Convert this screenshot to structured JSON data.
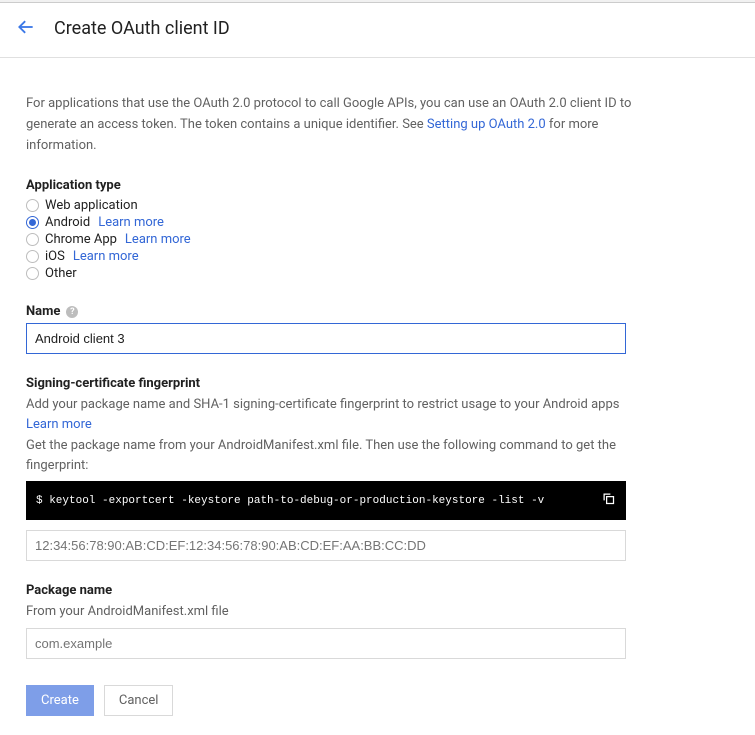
{
  "header": {
    "title": "Create OAuth client ID"
  },
  "intro": {
    "text_before": "For applications that use the OAuth 2.0 protocol to call Google APIs, you can use an OAuth 2.0 client ID to generate an access token. The token contains a unique identifier. See ",
    "link": "Setting up OAuth 2.0",
    "text_after": " for more information."
  },
  "app_type": {
    "label": "Application type",
    "options": [
      {
        "label": "Web application",
        "learn_more": null,
        "checked": false
      },
      {
        "label": "Android",
        "learn_more": "Learn more",
        "checked": true
      },
      {
        "label": "Chrome App",
        "learn_more": "Learn more",
        "checked": false
      },
      {
        "label": "iOS",
        "learn_more": "Learn more",
        "checked": false
      },
      {
        "label": "Other",
        "learn_more": null,
        "checked": false
      }
    ]
  },
  "name": {
    "label": "Name",
    "value": "Android client 3"
  },
  "fingerprint": {
    "label": "Signing-certificate fingerprint",
    "helper_before": "Add your package name and SHA-1 signing-certificate fingerprint to restrict usage to your Android apps ",
    "helper_link": "Learn more",
    "helper2": "Get the package name from your AndroidManifest.xml file. Then use the following command to get the fingerprint:",
    "command_prefix": "$ ",
    "command": "keytool -exportcert -keystore path-to-debug-or-production-keystore -list -v",
    "placeholder": "12:34:56:78:90:AB:CD:EF:12:34:56:78:90:AB:CD:EF:AA:BB:CC:DD"
  },
  "package": {
    "label": "Package name",
    "helper": "From your AndroidManifest.xml file",
    "placeholder": "com.example"
  },
  "actions": {
    "create": "Create",
    "cancel": "Cancel"
  }
}
